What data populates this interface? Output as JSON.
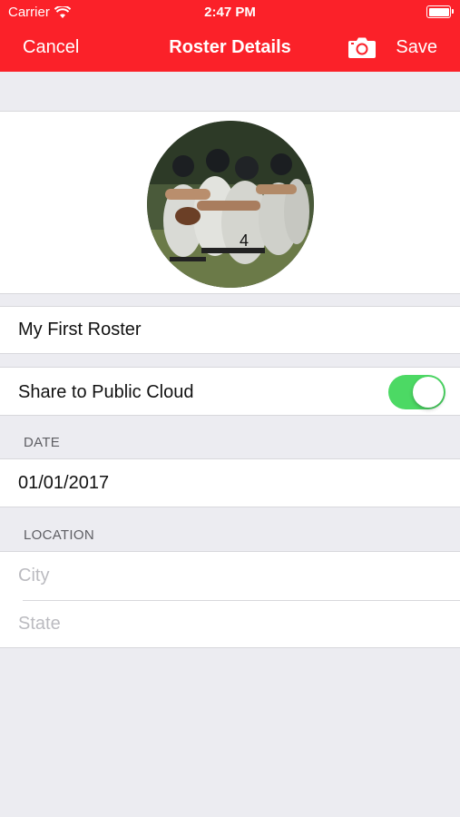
{
  "status_bar": {
    "carrier": "Carrier",
    "time": "2:47 PM",
    "wifi_icon": "wifi-icon",
    "battery_icon": "battery-icon"
  },
  "nav": {
    "cancel_label": "Cancel",
    "title": "Roster Details",
    "camera_icon": "camera-icon",
    "save_label": "Save"
  },
  "photo": {
    "description": "team-photo"
  },
  "roster": {
    "name": "My First Roster"
  },
  "share": {
    "label": "Share to Public Cloud",
    "enabled": true
  },
  "date_section": {
    "header": "DATE",
    "value": "01/01/2017"
  },
  "location_section": {
    "header": "LOCATION",
    "city_placeholder": "City",
    "state_placeholder": "State"
  },
  "colors": {
    "accent": "#FB2129",
    "toggle_on": "#4CD964",
    "background": "#ECECF1"
  }
}
